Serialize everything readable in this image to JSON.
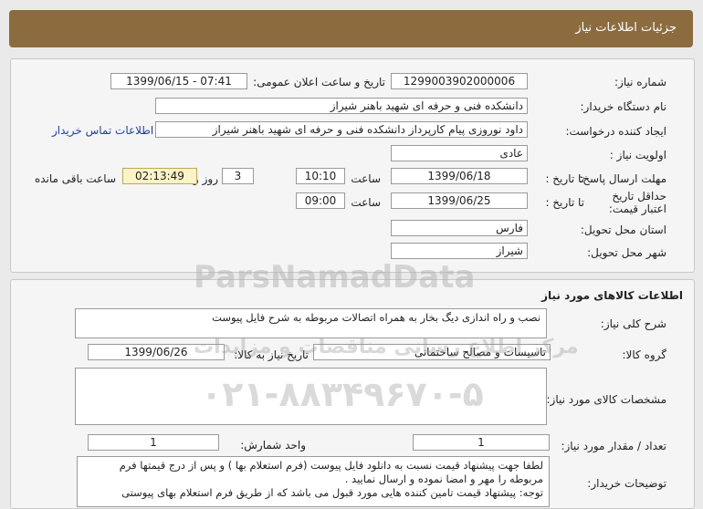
{
  "header": {
    "title": "جزئیات اطلاعات نیاز"
  },
  "info": {
    "need_number_label": "شماره نیاز:",
    "need_number": "1299003902000006",
    "announce_label": "تاریخ و ساعت اعلان عمومی:",
    "announce_value": "1399/06/15 - 07:41",
    "buyer_org_label": "نام دستگاه خریدار:",
    "buyer_org": "دانشکده فنی و حرفه ای شهید باهنر شیراز",
    "creator_label": "ایجاد کننده درخواست:",
    "creator": "داود نوروزی پیام کارپرداز دانشکده فنی و حرفه ای شهید باهنر شیراز",
    "contact_link": "اطلاعات تماس خریدار",
    "priority_label": "اولویت نیاز :",
    "priority": "عادی",
    "deadline_label": "مهلت ارسال پاسخ:",
    "until_date_label": "تا تاریخ :",
    "deadline_date": "1399/06/18",
    "time_label": "ساعت",
    "deadline_time": "10:10",
    "days_value": "3",
    "days_and_label": "روز و",
    "remaining_time": "02:13:49",
    "remaining_label": "ساعت باقی مانده",
    "validity_label": "حداقل تاریخ اعتبار قیمت:",
    "validity_until_label": "تا تاریخ :",
    "validity_date": "1399/06/25",
    "validity_time_label": "ساعت",
    "validity_time": "09:00",
    "province_label": "استان محل تحویل:",
    "province": "فارس",
    "city_label": "شهر محل تحویل:",
    "city": "شیراز"
  },
  "goods": {
    "section_title": "اطلاعات کالاهای مورد نیاز",
    "desc_label": "شرح کلی نیاز:",
    "desc": "نصب و راه اندازی دیگ بخار به همراه اتصالات  مربوطه به شرح فایل پیوست",
    "group_label": "گروه کالا:",
    "group": "تاسیسات و مصالح ساختمانی",
    "need_date_label": "تاریخ نیاز به کالا:",
    "need_date": "1399/06/26",
    "specs_label": "مشخصات کالای مورد نیاز:",
    "qty_label": "تعداد / مقدار مورد نیاز:",
    "qty": "1",
    "unit_label": "واحد شمارش:",
    "unit": "1",
    "notes_label": "توضیحات خریدار:",
    "notes_line1": "لطفا جهت پیشنهاد قیمت نسبت به دانلود فایل پیوست (فرم استعلام بها ) و پس از درج قیمتها فرم",
    "notes_line2": "مربوطه را مهر و امضا نموده و ارسال نمایید .",
    "notes_line3": "توجه: پیشنهاد قیمت تامین کننده هایی مورد قبول می باشد که از طریق فرم استعلام بهای پیوستی"
  },
  "watermark": {
    "brand": "ParsNamadData",
    "tagline": "مرکز اطلاع رسانی مناقصات و مزایدات",
    "phone": "۰۲۱-۸۸۳۴۹۶۷۰-۵"
  }
}
